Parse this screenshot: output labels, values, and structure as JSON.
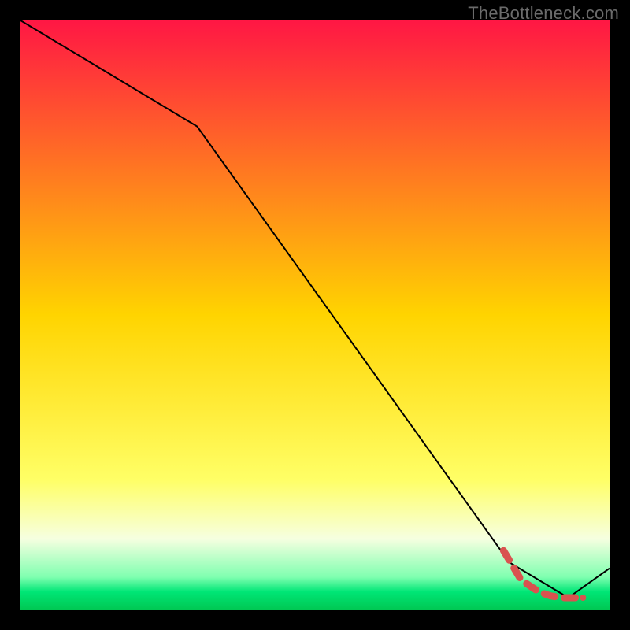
{
  "watermark": {
    "text": "TheBottleneck.com"
  },
  "chart_data": {
    "type": "line",
    "title": "",
    "xlabel": "",
    "ylabel": "",
    "xlim": [
      0,
      100
    ],
    "ylim": [
      0,
      100
    ],
    "grid": false,
    "legend": false,
    "background_gradient": {
      "stops": [
        {
          "pos": 0.0,
          "color": "#ff1744"
        },
        {
          "pos": 0.5,
          "color": "#ffd400"
        },
        {
          "pos": 0.78,
          "color": "#ffff66"
        },
        {
          "pos": 0.88,
          "color": "#f6ffe0"
        },
        {
          "pos": 0.945,
          "color": "#7fffb0"
        },
        {
          "pos": 0.97,
          "color": "#00e676"
        },
        {
          "pos": 1.0,
          "color": "#00c853"
        }
      ]
    },
    "series": [
      {
        "name": "bottleneck-curve",
        "style": "solid-thin-black",
        "x": [
          0,
          30,
          83,
          93,
          100
        ],
        "y": [
          100,
          82,
          8,
          2,
          7
        ]
      },
      {
        "name": "highlight-segment",
        "style": "dashed-thick-red",
        "x": [
          82,
          85,
          88,
          90,
          92,
          94,
          95.5
        ],
        "y": [
          10,
          5,
          3,
          2.3,
          2,
          2,
          2
        ]
      }
    ],
    "points": [
      {
        "name": "highlight-end-dot",
        "x": 95.5,
        "y": 2,
        "color": "#d9534f",
        "r": 4
      }
    ]
  }
}
